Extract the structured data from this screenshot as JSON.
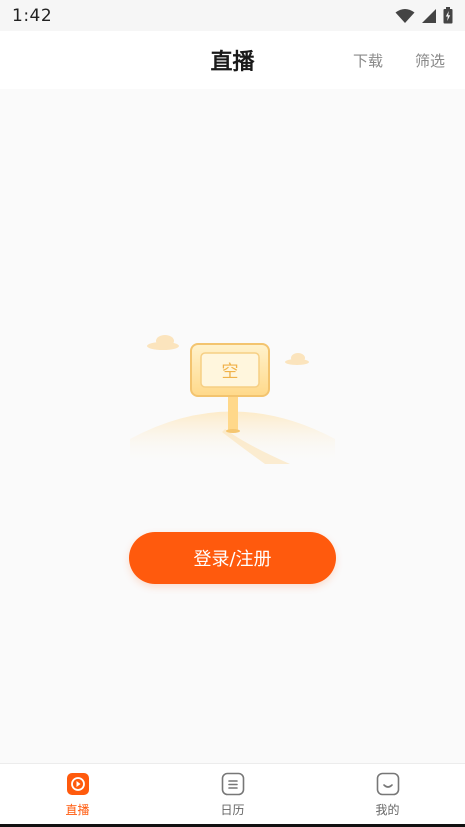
{
  "status_bar": {
    "time": "1:42",
    "icons": [
      "wifi-icon",
      "cell-signal-icon",
      "battery-charging-icon"
    ]
  },
  "header": {
    "title": "直播",
    "download_label": "下载",
    "filter_label": "筛选"
  },
  "empty_state": {
    "sign_text": "空",
    "login_button_label": "登录/注册"
  },
  "bottom_nav": {
    "items": [
      {
        "label": "直播",
        "icon": "live-play-icon",
        "active": true
      },
      {
        "label": "日历",
        "icon": "calendar-icon",
        "active": false
      },
      {
        "label": "我的",
        "icon": "profile-face-icon",
        "active": false
      }
    ]
  },
  "colors": {
    "accent": "#ff5a0d",
    "background": "#fafafa",
    "header_bg": "#ffffff",
    "inactive_text": "#666666"
  }
}
